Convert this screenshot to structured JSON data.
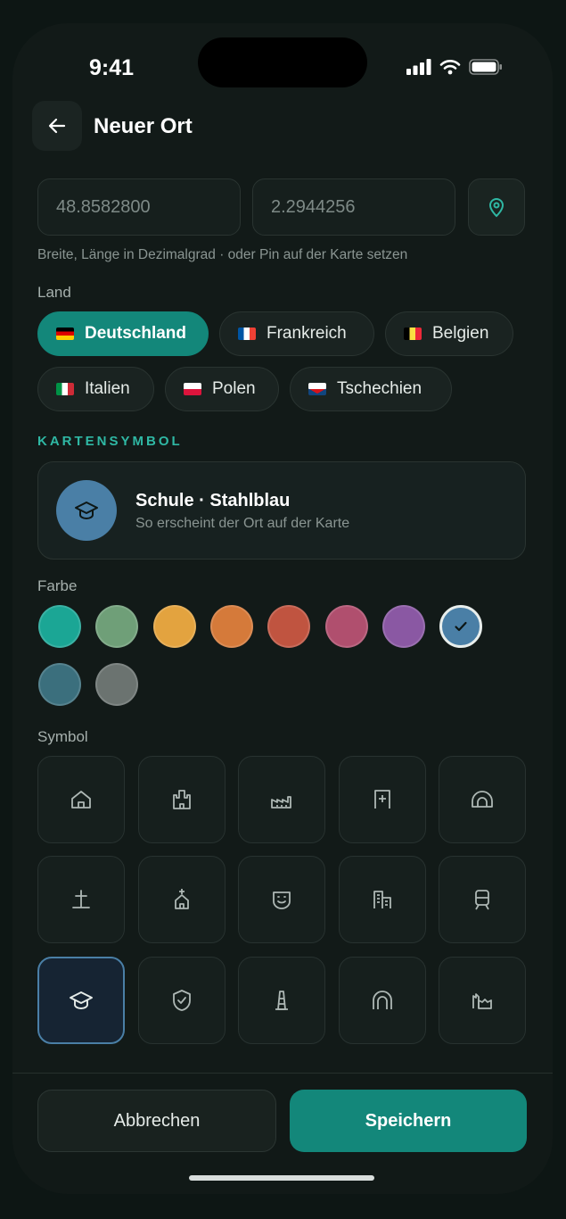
{
  "status_bar": {
    "time": "9:41"
  },
  "header": {
    "title": "Neuer Ort",
    "back_icon": "arrow-left-icon"
  },
  "coordinates": {
    "latitude": "48.8582800",
    "longitude": "2.2944256",
    "hint": "Breite, Länge in Dezimalgrad · oder Pin auf der Karte setzen"
  },
  "country": {
    "label": "Land",
    "options": [
      {
        "label": "Deutschland",
        "selected": true,
        "flag_colors": [
          "#000000",
          "#dd0000",
          "#ffce00"
        ]
      },
      {
        "label": "Frankreich",
        "selected": false,
        "flag_colors": [
          "#0055a4",
          "#ffffff",
          "#ef4135"
        ]
      },
      {
        "label": "Belgien",
        "selected": false,
        "flag_colors": [
          "#000000",
          "#fae042",
          "#ed2939"
        ]
      },
      {
        "label": "Italien",
        "selected": false,
        "flag_colors": [
          "#009246",
          "#ffffff",
          "#ce2b37"
        ]
      },
      {
        "label": "Polen",
        "selected": false,
        "flag_colors": [
          "#ffffff",
          "#dc143c"
        ]
      },
      {
        "label": "Tschechien",
        "selected": false,
        "flag_colors": [
          "#ffffff",
          "#d7141a",
          "#11457e"
        ]
      }
    ]
  },
  "map_symbol": {
    "section_title": "KARTENSYMBOL",
    "preview_title": "Schule · Stahlblau",
    "preview_subtitle": "So erscheint der Ort auf der Karte",
    "preview_icon": "graduation-cap-icon",
    "preview_color": "#4a7fa6"
  },
  "color": {
    "label": "Farbe",
    "swatches": [
      "#1ba695",
      "#6f9f78",
      "#e3a33f",
      "#d57a3a",
      "#c05440",
      "#b04f6e",
      "#8a58a3",
      "#4a7fa6",
      "#3b6f7d",
      "#6b7370"
    ],
    "selected_index": 7
  },
  "symbol": {
    "label": "Symbol",
    "icons": [
      "house-icon",
      "castle-icon",
      "factory-icon",
      "hospital-icon",
      "tunnel-icon",
      "cross-icon",
      "church-icon",
      "mask-icon",
      "building-icon",
      "tram-icon",
      "graduation-cap-icon",
      "shield-check-icon",
      "tower-icon",
      "arch-icon",
      "ruins-icon"
    ],
    "selected_index": 10
  },
  "actions": {
    "cancel": "Abbrechen",
    "save": "Speichern"
  }
}
